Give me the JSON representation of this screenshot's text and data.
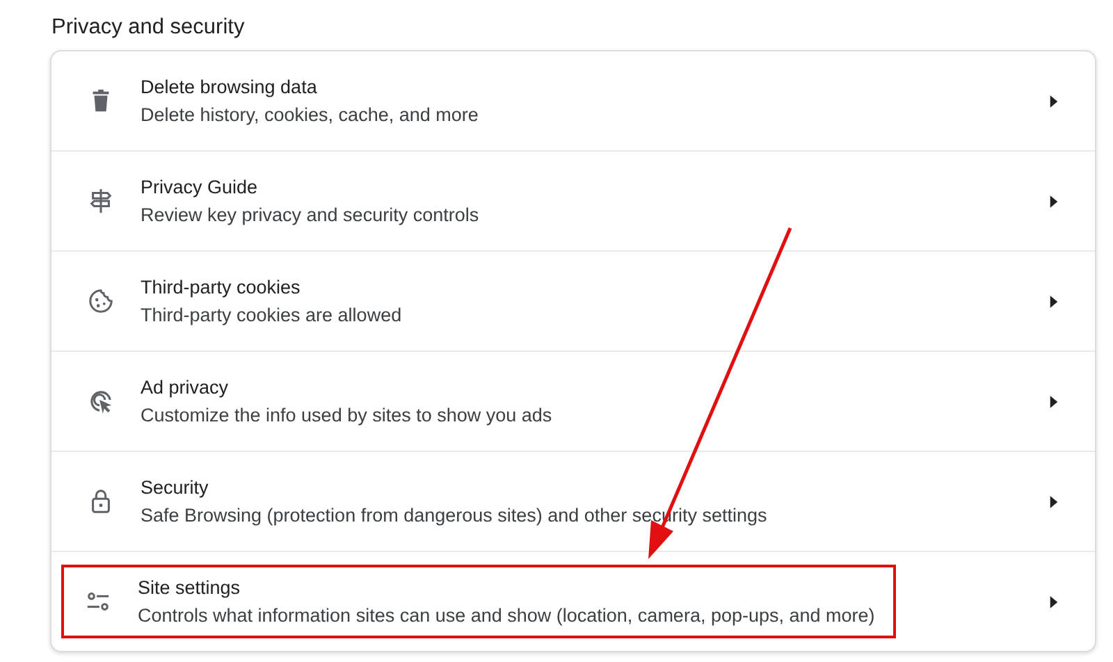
{
  "section_title": "Privacy and security",
  "items": [
    {
      "title": "Delete browsing data",
      "subtitle": "Delete history, cookies, cache, and more",
      "highlighted": false
    },
    {
      "title": "Privacy Guide",
      "subtitle": "Review key privacy and security controls",
      "highlighted": false
    },
    {
      "title": "Third-party cookies",
      "subtitle": "Third-party cookies are allowed",
      "highlighted": false
    },
    {
      "title": "Ad privacy",
      "subtitle": "Customize the info used by sites to show you ads",
      "highlighted": false
    },
    {
      "title": "Security",
      "subtitle": "Safe Browsing (protection from dangerous sites) and other security settings",
      "highlighted": false
    },
    {
      "title": "Site settings",
      "subtitle": "Controls what information sites can use and show (location, camera, pop-ups, and more)",
      "highlighted": true
    }
  ]
}
